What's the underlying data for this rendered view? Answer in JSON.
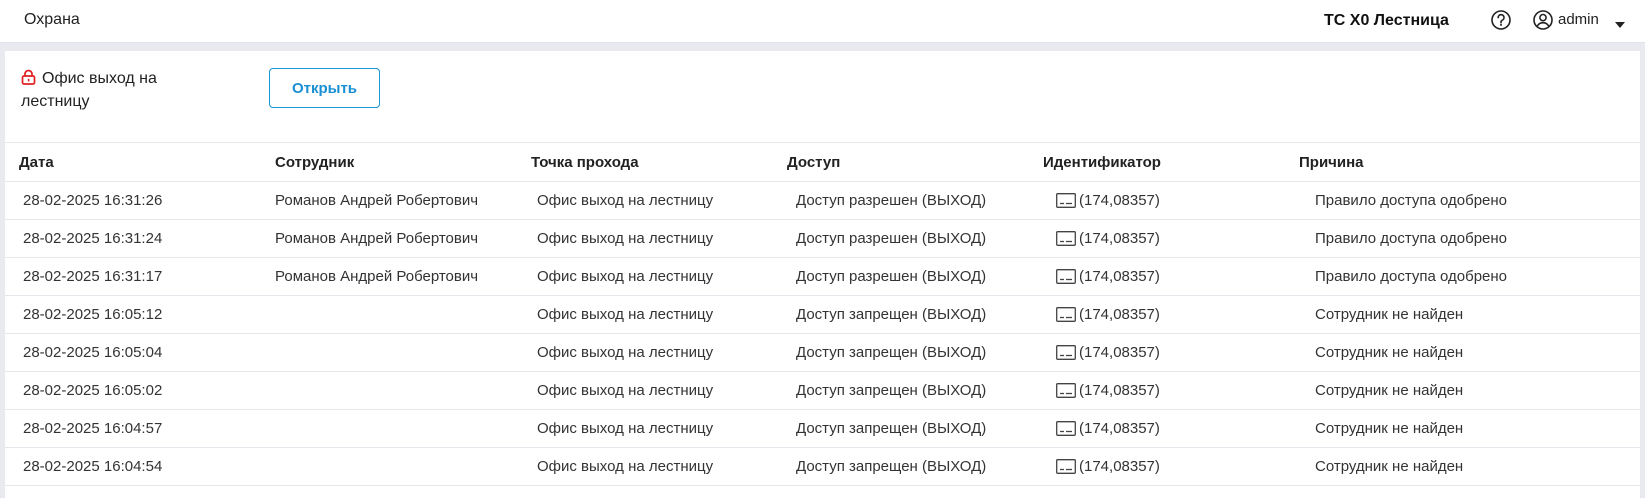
{
  "topbar": {
    "app_title": "Охрана",
    "site_name": "ТС Х0 Лестница",
    "help_icon": "question-circle-icon",
    "user_icon": "user-circle-icon",
    "user_name": "admin",
    "menu_icon": "caret-down-icon"
  },
  "door": {
    "lock_icon": "lock-icon",
    "lock_color": "#e02020",
    "name": "Офис выход на лестницу",
    "open_button_label": "Открыть",
    "accent_color": "#1a95d6"
  },
  "table": {
    "columns": [
      "Дата",
      "Сотрудник",
      "Точка прохода",
      "Доступ",
      "Идентификатор",
      "Причина"
    ],
    "id_icon": "card-icon",
    "rows": [
      {
        "date": "28-02-2025 16:31:26",
        "employee": "Романов Андрей Робертович",
        "point": "Офис выход на лестницу",
        "access": "Доступ разрешен (ВЫХОД)",
        "identifier": "(174,08357)",
        "reason": "Правило доступа одобрено"
      },
      {
        "date": "28-02-2025 16:31:24",
        "employee": "Романов Андрей Робертович",
        "point": "Офис выход на лестницу",
        "access": "Доступ разрешен (ВЫХОД)",
        "identifier": "(174,08357)",
        "reason": "Правило доступа одобрено"
      },
      {
        "date": "28-02-2025 16:31:17",
        "employee": "Романов Андрей Робертович",
        "point": "Офис выход на лестницу",
        "access": "Доступ разрешен (ВЫХОД)",
        "identifier": "(174,08357)",
        "reason": "Правило доступа одобрено"
      },
      {
        "date": "28-02-2025 16:05:12",
        "employee": "",
        "point": "Офис выход на лестницу",
        "access": "Доступ запрещен (ВЫХОД)",
        "identifier": "(174,08357)",
        "reason": "Сотрудник не найден"
      },
      {
        "date": "28-02-2025 16:05:04",
        "employee": "",
        "point": "Офис выход на лестницу",
        "access": "Доступ запрещен (ВЫХОД)",
        "identifier": "(174,08357)",
        "reason": "Сотрудник не найден"
      },
      {
        "date": "28-02-2025 16:05:02",
        "employee": "",
        "point": "Офис выход на лестницу",
        "access": "Доступ запрещен (ВЫХОД)",
        "identifier": "(174,08357)",
        "reason": "Сотрудник не найден"
      },
      {
        "date": "28-02-2025 16:04:57",
        "employee": "",
        "point": "Офис выход на лестницу",
        "access": "Доступ запрещен (ВЫХОД)",
        "identifier": "(174,08357)",
        "reason": "Сотрудник не найден"
      },
      {
        "date": "28-02-2025 16:04:54",
        "employee": "",
        "point": "Офис выход на лестницу",
        "access": "Доступ запрещен (ВЫХОД)",
        "identifier": "(174,08357)",
        "reason": "Сотрудник не найден"
      }
    ]
  }
}
